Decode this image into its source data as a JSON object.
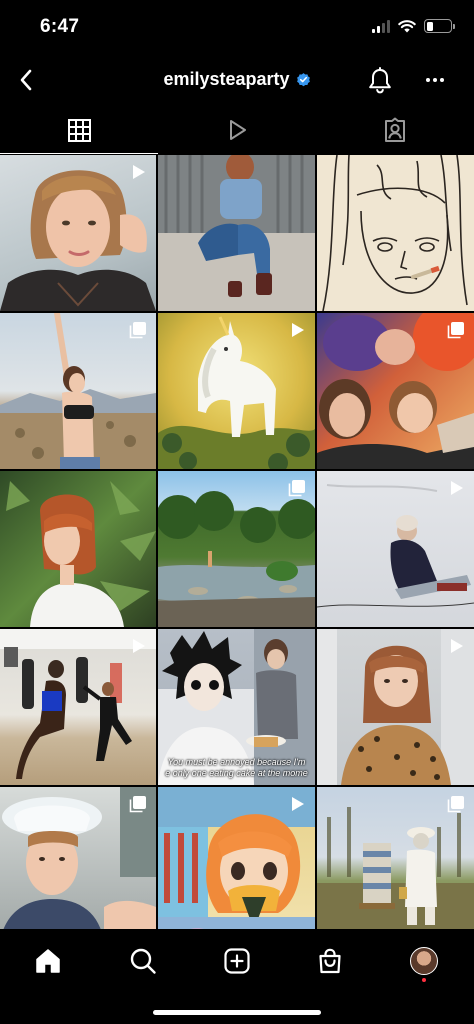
{
  "status_bar": {
    "time": "6:47",
    "battery_level": 0.28
  },
  "header": {
    "username": "emilysteaparty",
    "verified": true,
    "icons": {
      "back": "chevron-left-icon",
      "bell": "bell-icon",
      "more": "more-horizontal-icon"
    },
    "colors": {
      "verified_badge": "#3797f0"
    }
  },
  "tabs": [
    {
      "name": "posts-grid",
      "icon": "grid-icon",
      "active": true
    },
    {
      "name": "reels",
      "icon": "reels-play-icon",
      "active": false
    },
    {
      "name": "tagged",
      "icon": "tagged-person-icon",
      "active": false
    }
  ],
  "grid": {
    "posts": [
      {
        "badge": "reel",
        "subject": "woman with bob hair, black tee"
      },
      {
        "badge": "none",
        "subject": "person sitting against corrugated wall, denim"
      },
      {
        "badge": "none",
        "subject": "manga drawing of girl with cigarette"
      },
      {
        "badge": "carousel",
        "subject": "woman stretching in desert"
      },
      {
        "badge": "reel",
        "subject": "animated white unicorn"
      },
      {
        "badge": "carousel",
        "subject": "group selfie"
      },
      {
        "badge": "none",
        "subject": "profile with red bob, white tee"
      },
      {
        "badge": "carousel",
        "subject": "river landscape"
      },
      {
        "badge": "reel",
        "subject": "person sledding in snow"
      },
      {
        "badge": "reel",
        "subject": "boxing gym"
      },
      {
        "badge": "none",
        "subject": "anime character eating cake",
        "caption_line1": "You must be annoyed because I'm",
        "caption_line2": "e only one eating cake at the mome"
      },
      {
        "badge": "reel",
        "subject": "woman in leopard print top"
      },
      {
        "badge": "carousel",
        "subject": "woman in bucket hat in car"
      },
      {
        "badge": "reel",
        "subject": "anime girl with orange hair eating"
      },
      {
        "badge": "carousel",
        "subject": "beekeeper with hives"
      }
    ]
  },
  "bottom_nav": [
    {
      "name": "home",
      "icon": "home-icon",
      "active": true
    },
    {
      "name": "search",
      "icon": "search-icon",
      "active": false
    },
    {
      "name": "create",
      "icon": "plus-square-icon",
      "active": false
    },
    {
      "name": "shop",
      "icon": "shopping-bag-icon",
      "active": false
    },
    {
      "name": "profile",
      "icon": "avatar",
      "active": false,
      "notification": true
    }
  ]
}
